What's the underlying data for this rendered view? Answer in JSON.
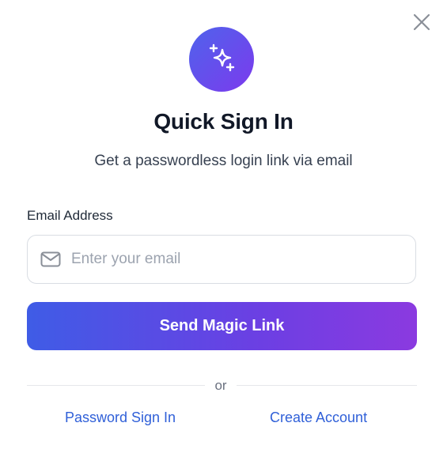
{
  "dialog": {
    "close_icon": "close-icon",
    "logo_icon": "sparkles-icon",
    "title": "Quick Sign In",
    "subtitle": "Get a passwordless login link via email",
    "email": {
      "label": "Email Address",
      "placeholder": "Enter your email",
      "value": "",
      "icon": "mail-icon"
    },
    "send_button_label": "Send Magic Link",
    "divider_text": "or",
    "links": {
      "password_sign_in": "Password Sign In",
      "create_account": "Create Account"
    },
    "colors": {
      "accent_start": "#3f5ce6",
      "accent_end": "#8b3ae0",
      "link": "#3060d8",
      "title": "#111827"
    }
  }
}
